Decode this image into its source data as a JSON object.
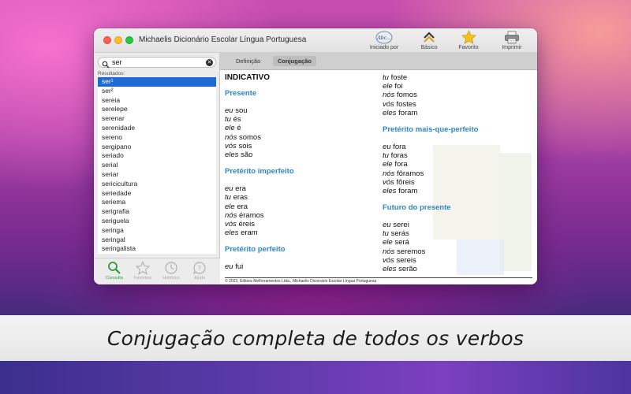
{
  "caption": "Conjugação completa de todos os verbos",
  "window": {
    "title": "Michaelis Dicionário Escolar Língua Portuguesa"
  },
  "toolbar": {
    "iniciado": {
      "label": "Iniciado por",
      "icon": "abc-icon",
      "icon_text": "Abc..."
    },
    "basico": {
      "label": "Básico",
      "icon": "level-chevrons-icon"
    },
    "favorito": {
      "label": "Favorito",
      "icon": "star-icon"
    },
    "imprimir": {
      "label": "Imprimir",
      "icon": "printer-icon"
    }
  },
  "search": {
    "value": "ser"
  },
  "results": {
    "label": "Resultados:",
    "items": [
      {
        "word": "ser¹",
        "selected": true
      },
      {
        "word": "ser²"
      },
      {
        "word": "sereia"
      },
      {
        "word": "serelepe"
      },
      {
        "word": "serenar"
      },
      {
        "word": "serenidade"
      },
      {
        "word": "sereno"
      },
      {
        "word": "sergipano"
      },
      {
        "word": "seriado"
      },
      {
        "word": "serial"
      },
      {
        "word": "seriar"
      },
      {
        "word": "sericicultura"
      },
      {
        "word": "seriedade"
      },
      {
        "word": "seriema"
      },
      {
        "word": "serigrafia"
      },
      {
        "word": "seriguela"
      },
      {
        "word": "seringa"
      },
      {
        "word": "seringal"
      },
      {
        "word": "seringalista"
      }
    ]
  },
  "tabs": {
    "consulta": "Consulta",
    "favoritos": "Favoritos",
    "historico": "Histórico",
    "ajuda": "Ajuda"
  },
  "segments": {
    "definicao": "Definição",
    "conjugacao": "Conjugação"
  },
  "conjugation": {
    "mode": "INDICATIVO",
    "presente": {
      "title": "Presente",
      "lines": [
        [
          "eu",
          "sou"
        ],
        [
          "tu",
          "és"
        ],
        [
          "ele",
          "é"
        ],
        [
          "nós",
          "somos"
        ],
        [
          "vós",
          "sois"
        ],
        [
          "eles",
          "são"
        ]
      ]
    },
    "imperfeito": {
      "title": "Pretérito imperfeito",
      "lines": [
        [
          "eu",
          "era"
        ],
        [
          "tu",
          "eras"
        ],
        [
          "ele",
          "era"
        ],
        [
          "nós",
          "éramos"
        ],
        [
          "vós",
          "éreis"
        ],
        [
          "eles",
          "eram"
        ]
      ]
    },
    "perfeito": {
      "title": "Pretérito perfeito",
      "lines_left": [
        [
          "eu",
          "fui"
        ]
      ],
      "lines_right": [
        [
          "tu",
          "foste"
        ],
        [
          "ele",
          "foi"
        ],
        [
          "nós",
          "fomos"
        ],
        [
          "vós",
          "fostes"
        ],
        [
          "eles",
          "foram"
        ]
      ]
    },
    "mais_que_perfeito": {
      "title": "Pretérito mais-que-perfeito",
      "lines": [
        [
          "eu",
          "fora"
        ],
        [
          "tu",
          "foras"
        ],
        [
          "ele",
          "fora"
        ],
        [
          "nós",
          "fôramos"
        ],
        [
          "vós",
          "fôreis"
        ],
        [
          "eles",
          "foram"
        ]
      ]
    },
    "futuro": {
      "title": "Futuro do presente",
      "lines": [
        [
          "eu",
          "serei"
        ],
        [
          "tu",
          "serás"
        ],
        [
          "ele",
          "será"
        ],
        [
          "nós",
          "seremos"
        ],
        [
          "vós",
          "sereis"
        ],
        [
          "eles",
          "serão"
        ]
      ]
    }
  },
  "copyright": "© 2023, Editora Melhoramentos Ltda., Michaelis Dicionário Escolar Língua Portuguesa"
}
